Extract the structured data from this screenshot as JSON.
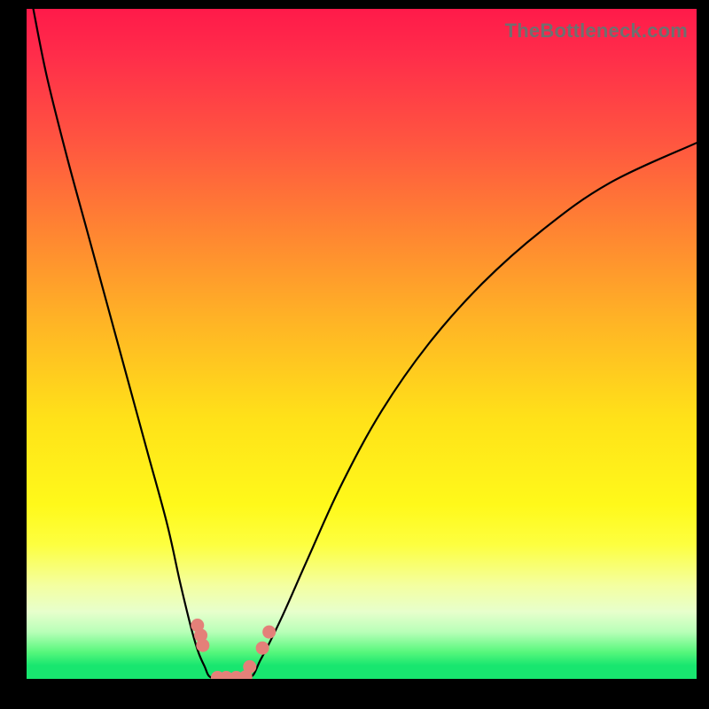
{
  "watermark": "TheBottleneck.com",
  "colors": {
    "frame_bg_top": "#ff1a4a",
    "frame_bg_bottom": "#18e66f",
    "curve_stroke": "#000000",
    "marker_fill": "#e48079",
    "page_bg": "#000000",
    "watermark_text": "#6f6f6f"
  },
  "chart_data": {
    "type": "line",
    "title": "",
    "xlabel": "",
    "ylabel": "",
    "xlim": [
      0,
      100
    ],
    "ylim": [
      0,
      100
    ],
    "grid": false,
    "legend": false,
    "series": [
      {
        "name": "left-branch",
        "x": [
          1,
          3,
          6,
          9,
          12,
          15,
          18,
          21,
          23,
          25,
          26.5,
          28
        ],
        "y": [
          100,
          90,
          78,
          67,
          56,
          45,
          34,
          23,
          14,
          6,
          2,
          0
        ]
      },
      {
        "name": "floor",
        "x": [
          28,
          33
        ],
        "y": [
          0,
          0
        ]
      },
      {
        "name": "right-branch",
        "x": [
          33,
          35,
          38,
          42,
          47,
          53,
          60,
          68,
          77,
          87,
          100
        ],
        "y": [
          0,
          3,
          9,
          18,
          29,
          40,
          50,
          59,
          67,
          74,
          80
        ]
      }
    ],
    "markers": [
      {
        "x": 25.5,
        "y": 8
      },
      {
        "x": 26.0,
        "y": 6.5
      },
      {
        "x": 26.3,
        "y": 5
      },
      {
        "x": 28.5,
        "y": 0.2
      },
      {
        "x": 29.8,
        "y": 0.2
      },
      {
        "x": 31.3,
        "y": 0.2
      },
      {
        "x": 32.7,
        "y": 0.3
      },
      {
        "x": 33.3,
        "y": 1.8
      },
      {
        "x": 35.2,
        "y": 4.6
      },
      {
        "x": 36.2,
        "y": 7.0
      }
    ],
    "gradient_stops": [
      {
        "offset": 0,
        "color": "#ff1a4a"
      },
      {
        "offset": 7,
        "color": "#ff2d4a"
      },
      {
        "offset": 20,
        "color": "#ff5640"
      },
      {
        "offset": 33,
        "color": "#ff8432"
      },
      {
        "offset": 47,
        "color": "#ffb525"
      },
      {
        "offset": 61,
        "color": "#ffe119"
      },
      {
        "offset": 74,
        "color": "#fff91a"
      },
      {
        "offset": 80,
        "color": "#fdff40"
      },
      {
        "offset": 86,
        "color": "#f4ffa0"
      },
      {
        "offset": 90,
        "color": "#e7ffcc"
      },
      {
        "offset": 93,
        "color": "#b8ffb8"
      },
      {
        "offset": 96,
        "color": "#57f77c"
      },
      {
        "offset": 98,
        "color": "#18e66f"
      },
      {
        "offset": 100,
        "color": "#18e66f"
      }
    ]
  }
}
